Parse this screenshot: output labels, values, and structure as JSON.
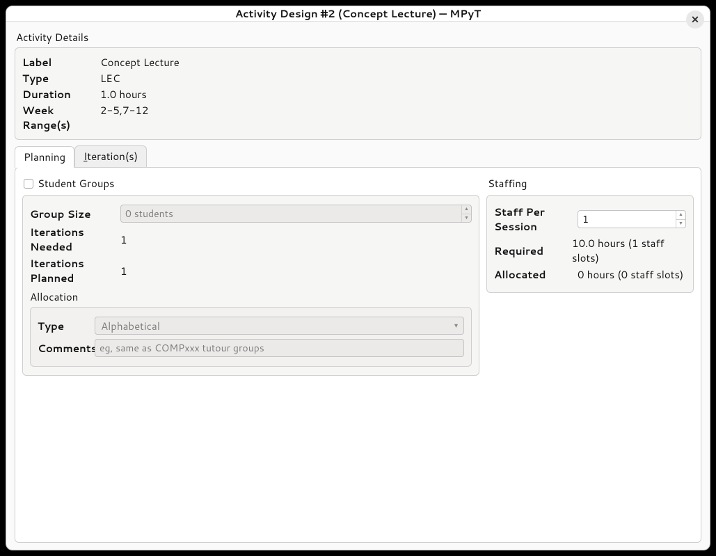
{
  "window": {
    "title": "Activity Design #2 (Concept Lecture) — MPyT"
  },
  "details": {
    "section_title": "Activity Details",
    "rows": {
      "label": {
        "k": "Label",
        "v": "Concept Lecture"
      },
      "type": {
        "k": "Type",
        "v": "LEC"
      },
      "duration": {
        "k": "Duration",
        "v": "1.0 hours"
      },
      "weekrange": {
        "k": "Week Range(s)",
        "v": "2-5,7-12"
      }
    }
  },
  "tabs": {
    "planning": "Planning",
    "iterations_prefix": "I",
    "iterations_rest": "teration(s)"
  },
  "student_groups": {
    "header": "Student Groups",
    "group_size_label": "Group Size",
    "group_size_value": "0 students",
    "iterations_needed_label": "Iterations Needed",
    "iterations_needed_value": "1",
    "iterations_planned_label": "Iterations Planned",
    "iterations_planned_value": "1",
    "allocation_label": "Allocation",
    "allocation": {
      "type_label": "Type",
      "type_value": "Alphabetical",
      "comments_label": "Comments",
      "comments_placeholder": "eg, same as COMPxxx tutour groups"
    }
  },
  "staffing": {
    "header": "Staffing",
    "staff_per_session_label": "Staff Per Session",
    "staff_per_session_value": "1",
    "required_label": "Required",
    "required_value": "10.0 hours (1 staff slots)",
    "allocated_label": "Allocated",
    "allocated_value": "0 hours (0 staff slots)"
  }
}
